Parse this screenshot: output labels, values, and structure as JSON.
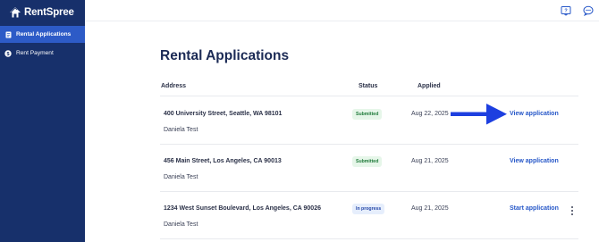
{
  "brand": {
    "name": "RentSpree"
  },
  "sidebar": {
    "items": [
      {
        "label": "Rental Applications",
        "icon": "document-icon",
        "active": true
      },
      {
        "label": "Rent Payment",
        "icon": "dollar-icon",
        "active": false
      }
    ]
  },
  "topbar": {
    "icons": [
      "help-icon",
      "chat-icon"
    ]
  },
  "page": {
    "title": "Rental Applications"
  },
  "table": {
    "headers": {
      "address": "Address",
      "status": "Status",
      "applied": "Applied"
    },
    "rows": [
      {
        "address": "400 University Street, Seattle, WA 98101",
        "tenant": "Daniela Test",
        "status": "Submitted",
        "date": "Aug 22, 2025",
        "action": "View application"
      },
      {
        "address": "456 Main Street, Los Angeles, CA 90013",
        "tenant": "Daniela Test",
        "status": "Submitted",
        "date": "Aug 21, 2025",
        "action": "View application"
      },
      {
        "address": "1234 West Sunset Boulevard, Los Angeles, CA 90026",
        "tenant": "Daniela Test",
        "status": "In progress",
        "date": "Aug 21, 2025",
        "action": "Start application"
      }
    ]
  },
  "colors": {
    "sidebar": "#17306b",
    "active": "#2d5bc7",
    "link": "#2657c8",
    "arrow": "#1d3fe0"
  }
}
